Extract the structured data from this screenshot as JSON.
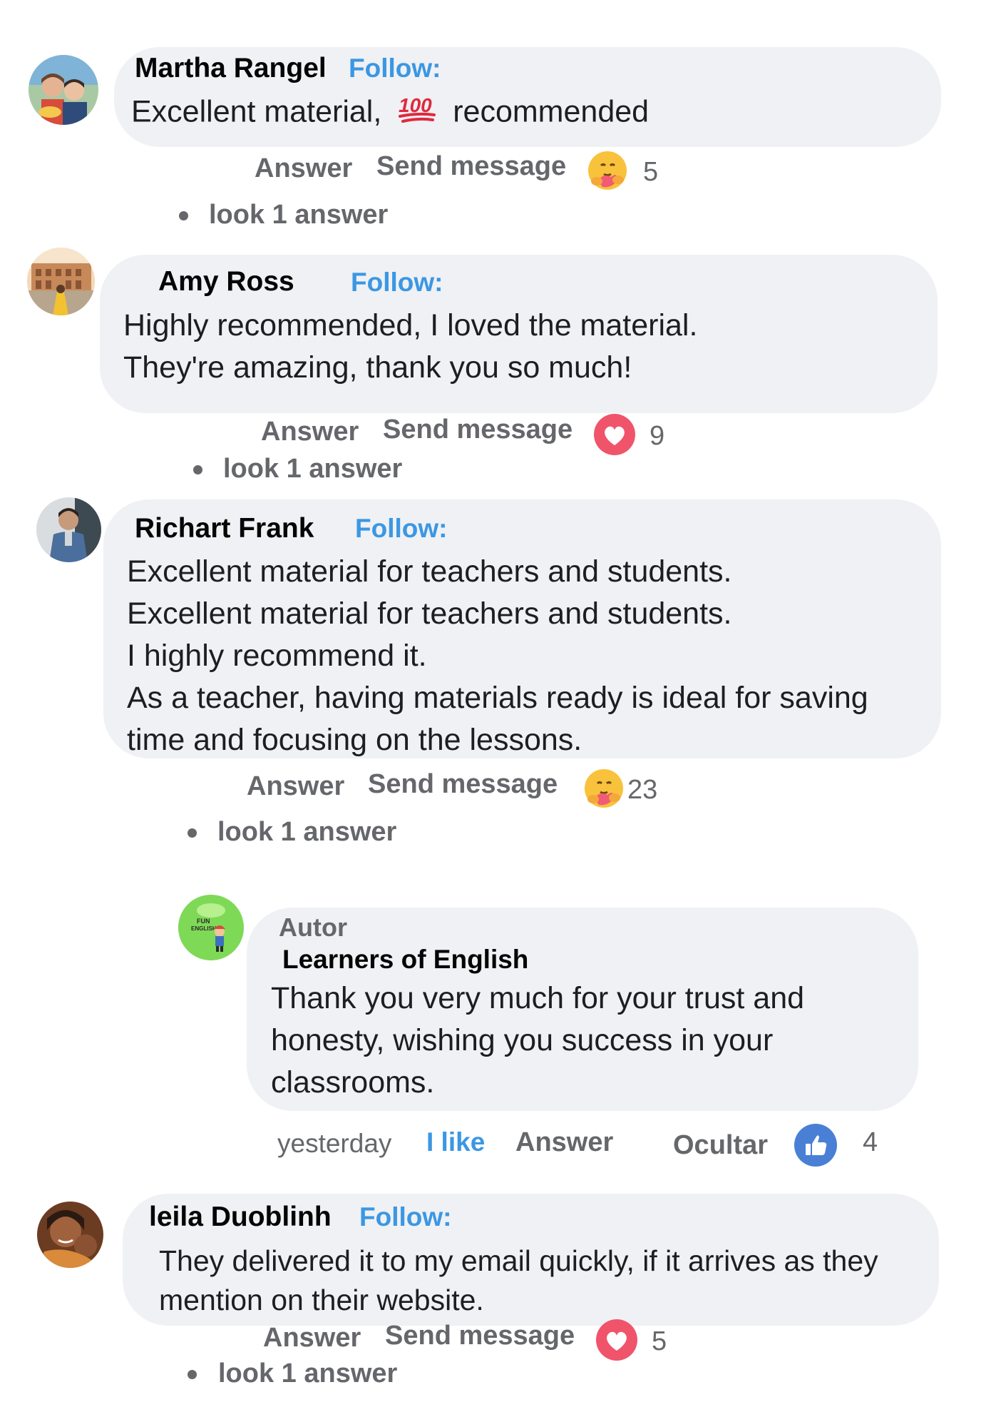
{
  "comments": [
    {
      "author": "Martha Rangel",
      "follow": "Follow:",
      "text_before": "Excellent material,",
      "emoji_100": "100",
      "text_after": "recommended",
      "answer": "Answer",
      "send_message": "Send message",
      "reaction": "hug",
      "count": "5",
      "look": "look 1 answer"
    },
    {
      "author": "Amy Ross",
      "follow": "Follow:",
      "text": "Highly recommended, I loved the material.\nThey're amazing, thank you so much!",
      "answer": "Answer",
      "send_message": "Send message",
      "reaction": "love",
      "count": "9",
      "look": "look 1 answer"
    },
    {
      "author": "Richart Frank",
      "follow": "Follow:",
      "text": "Excellent material for teachers and students.\nExcellent material for teachers and students.\nI highly recommend it.\nAs a teacher, having materials ready is ideal for saving\ntime and focusing on the lessons.",
      "answer": "Answer",
      "send_message": "Send message",
      "reaction": "hug",
      "count": "23",
      "look": "look 1 answer"
    },
    {
      "author": "leila Duoblinh",
      "follow": "Follow:",
      "text": "They delivered it to my email quickly, if it arrives as they\nmention on their website.",
      "answer": "Answer",
      "send_message": "Send message",
      "reaction": "love",
      "count": "5",
      "look": "look 1 answer"
    }
  ],
  "reply": {
    "role": "Autor",
    "author": "Learners of English",
    "avatar_text": "FUN\nENGLISH",
    "text": "Thank you very much for your trust and\nhonesty, wishing you success in your\nclassrooms.",
    "time": "yesterday",
    "like": "I like",
    "answer": "Answer",
    "hide": "Ocultar",
    "reaction": "like",
    "count": "4"
  },
  "colors": {
    "bubble": "#eff1f4",
    "follow": "#3b97e3",
    "muted": "#65676b",
    "love": "#f0546b",
    "like": "#4a7fd6"
  }
}
